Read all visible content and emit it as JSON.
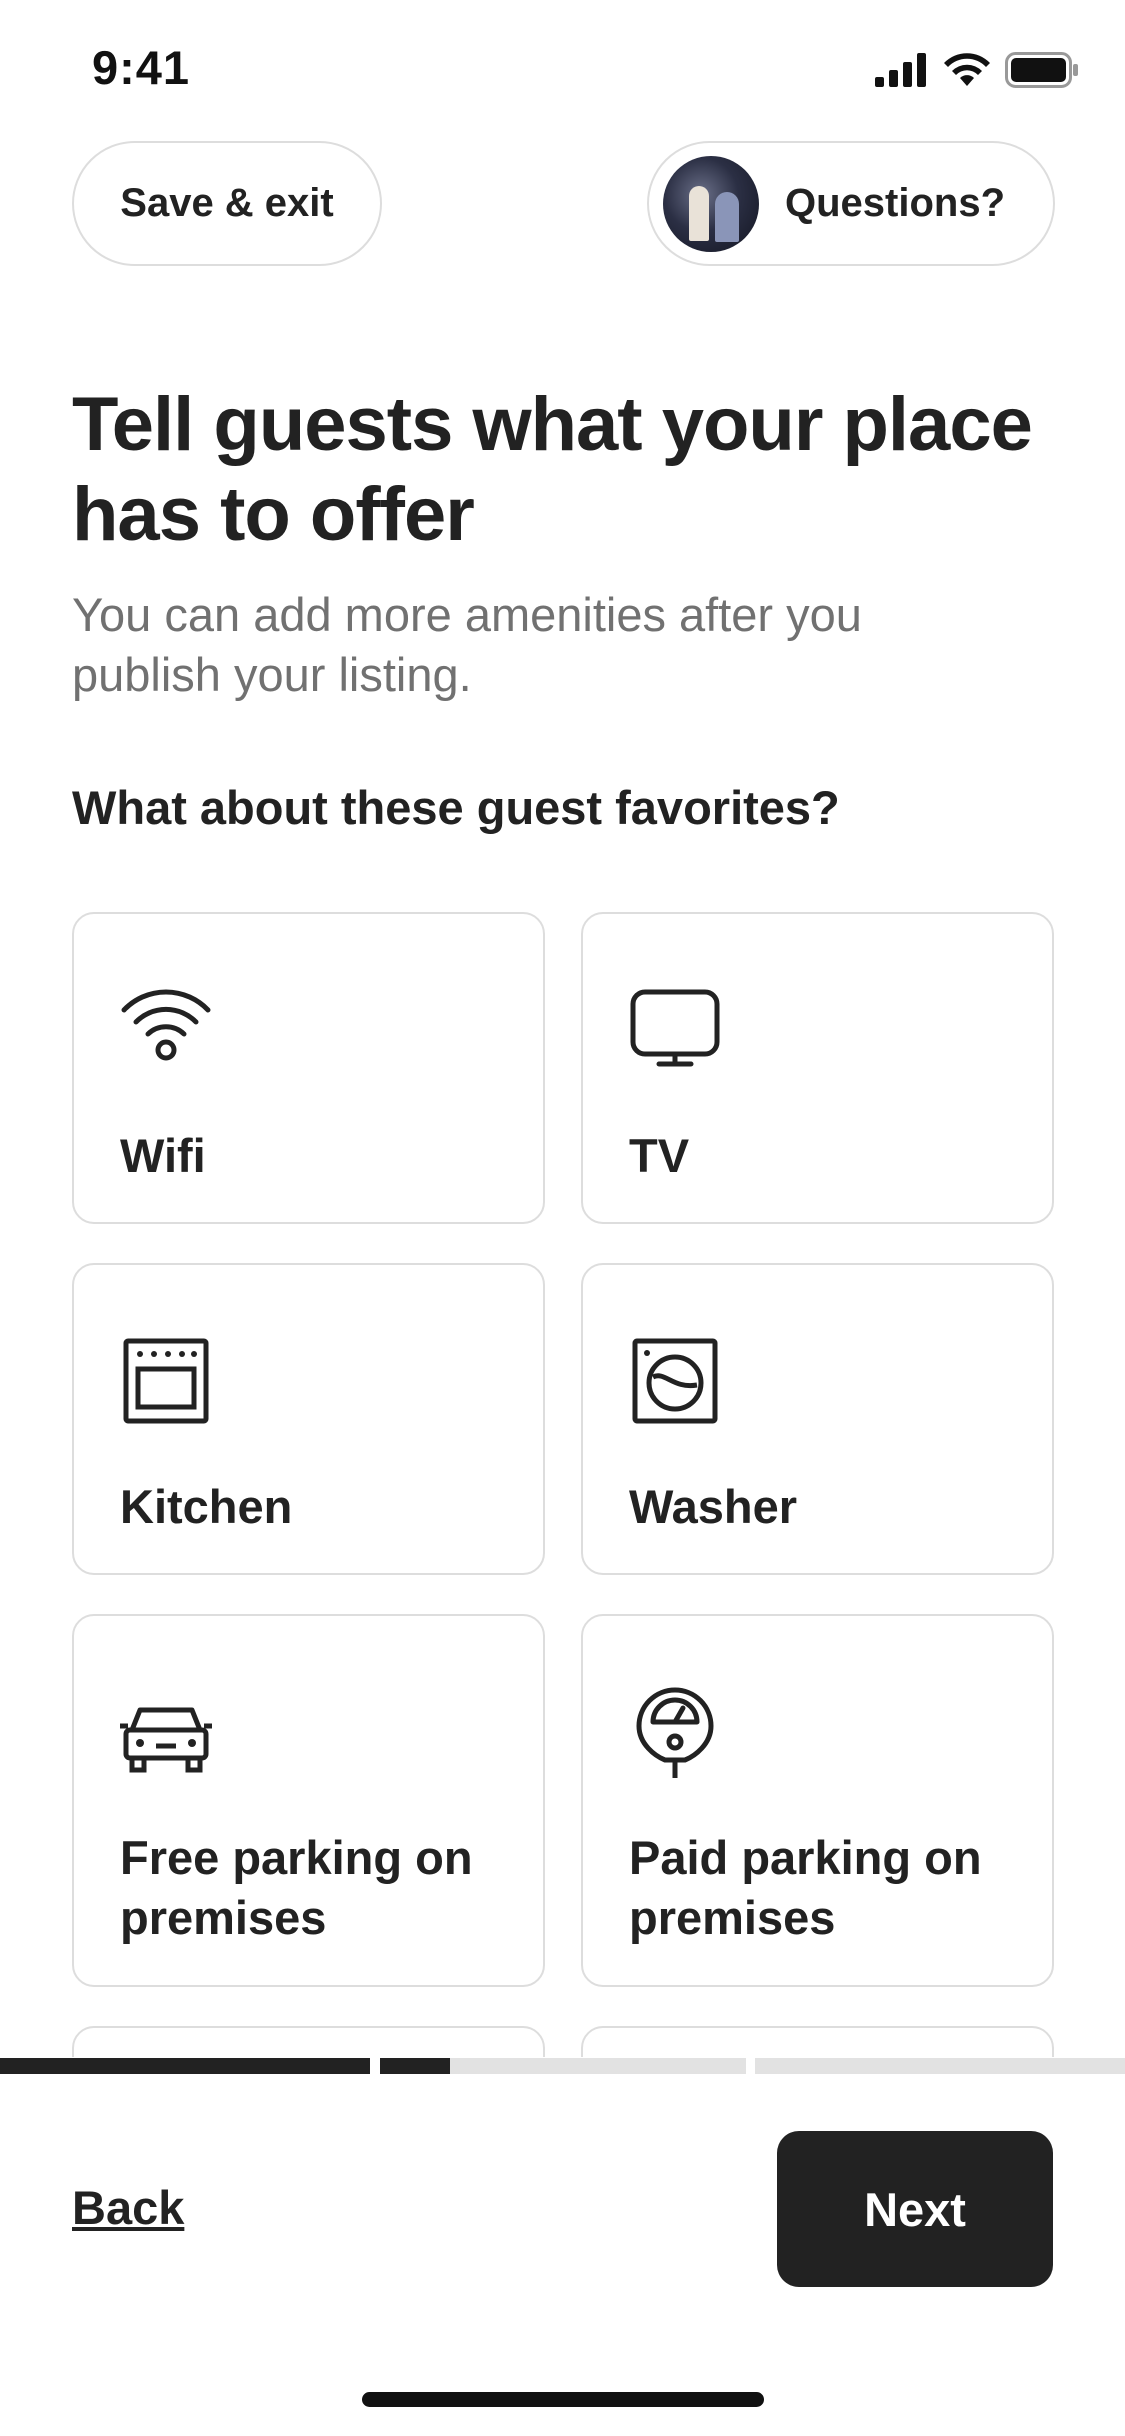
{
  "status_bar": {
    "time": "9:41",
    "icons": [
      "cellular-signal-icon",
      "wifi-icon",
      "battery-icon"
    ]
  },
  "header": {
    "save_exit_label": "Save & exit",
    "questions_label": "Questions?"
  },
  "page": {
    "title": "Tell guests what your place has to offer",
    "subtitle": "You can add more amenities after you publish your listing.",
    "section_heading": "What about these guest favorites?"
  },
  "amenities": [
    {
      "label": "Wifi",
      "icon": "wifi-icon"
    },
    {
      "label": "TV",
      "icon": "tv-icon"
    },
    {
      "label": "Kitchen",
      "icon": "oven-icon"
    },
    {
      "label": "Washer",
      "icon": "washer-icon"
    },
    {
      "label": "Free parking on premises",
      "icon": "car-icon"
    },
    {
      "label": "Paid parking on premises",
      "icon": "parking-meter-icon"
    }
  ],
  "progress": {
    "segments": [
      {
        "fill": 1.0
      },
      {
        "fill": 0.19
      },
      {
        "fill": 0.0
      }
    ]
  },
  "footer": {
    "back_label": "Back",
    "next_label": "Next"
  },
  "colors": {
    "text": "#222222",
    "muted": "#717171",
    "border": "#dddddd",
    "primary_button": "#222222",
    "progress_track": "#e2e2e2"
  }
}
